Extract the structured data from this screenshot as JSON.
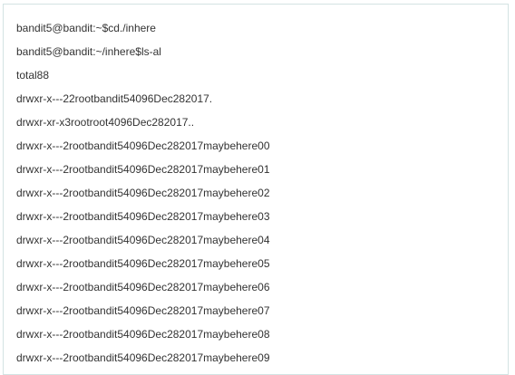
{
  "terminal": {
    "lines": [
      "bandit5@bandit:~$cd./inhere",
      "bandit5@bandit:~/inhere$ls-al",
      "total88",
      "drwxr-x---22rootbandit54096Dec282017.",
      "drwxr-xr-x3rootroot4096Dec282017..",
      "drwxr-x---2rootbandit54096Dec282017maybehere00",
      "drwxr-x---2rootbandit54096Dec282017maybehere01",
      "drwxr-x---2rootbandit54096Dec282017maybehere02",
      "drwxr-x---2rootbandit54096Dec282017maybehere03",
      "drwxr-x---2rootbandit54096Dec282017maybehere04",
      "drwxr-x---2rootbandit54096Dec282017maybehere05",
      "drwxr-x---2rootbandit54096Dec282017maybehere06",
      "drwxr-x---2rootbandit54096Dec282017maybehere07",
      "drwxr-x---2rootbandit54096Dec282017maybehere08",
      "drwxr-x---2rootbandit54096Dec282017maybehere09"
    ]
  }
}
